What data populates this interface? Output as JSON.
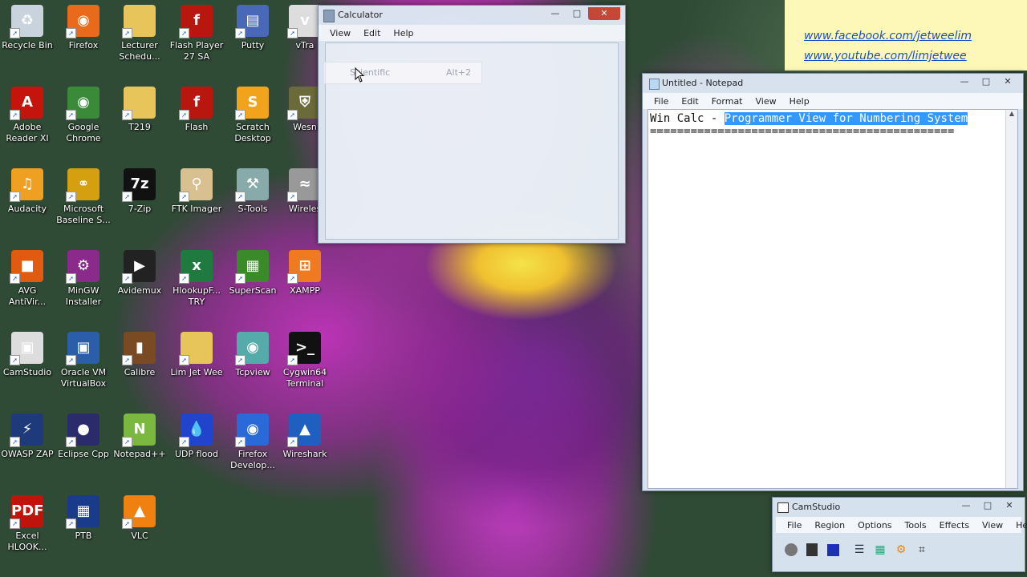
{
  "desktop_icons": [
    {
      "label": "Recycle Bin",
      "icon": "recycle-bin-icon"
    },
    {
      "label": "Firefox",
      "icon": "firefox-icon"
    },
    {
      "label": "Lecturer Schedu...",
      "icon": "folder-icon"
    },
    {
      "label": "Flash Player 27 SA",
      "icon": "flash-icon"
    },
    {
      "label": "Putty",
      "icon": "putty-icon"
    },
    {
      "label": "vTra",
      "icon": "vtrace-icon"
    },
    {
      "label": "Adobe Reader XI",
      "icon": "adobe-reader-icon"
    },
    {
      "label": "Google Chrome",
      "icon": "chrome-icon"
    },
    {
      "label": "T219",
      "icon": "folder-icon"
    },
    {
      "label": "Flash",
      "icon": "flash-icon"
    },
    {
      "label": "Scratch Desktop",
      "icon": "scratch-icon"
    },
    {
      "label": "Wesn",
      "icon": "shield-icon"
    },
    {
      "label": "Audacity",
      "icon": "audacity-icon"
    },
    {
      "label": "Microsoft Baseline S...",
      "icon": "lock-icon"
    },
    {
      "label": "7-Zip",
      "icon": "7zip-icon"
    },
    {
      "label": "FTK Imager",
      "icon": "magnifier-icon"
    },
    {
      "label": "S-Tools",
      "icon": "tools-icon"
    },
    {
      "label": "Wireles",
      "icon": "wireless-icon"
    },
    {
      "label": "AVG AntiVir...",
      "icon": "avg-icon"
    },
    {
      "label": "MinGW Installer",
      "icon": "mingw-icon"
    },
    {
      "label": "Avidemux",
      "icon": "clapper-icon"
    },
    {
      "label": "HlookupF... TRY",
      "icon": "excel-icon"
    },
    {
      "label": "SuperScan",
      "icon": "superscan-icon"
    },
    {
      "label": "XAMPP",
      "icon": "xampp-icon"
    },
    {
      "label": "CamStudio",
      "icon": "camstudio-icon"
    },
    {
      "label": "Oracle VM VirtualBox",
      "icon": "virtualbox-icon"
    },
    {
      "label": "Calibre",
      "icon": "books-icon"
    },
    {
      "label": "Lim Jet Wee",
      "icon": "folder-icon"
    },
    {
      "label": "Tcpview",
      "icon": "tcpview-icon"
    },
    {
      "label": "Cygwin64 Terminal",
      "icon": "terminal-icon"
    },
    {
      "label": "OWASP ZAP",
      "icon": "zap-icon"
    },
    {
      "label": "Eclipse Cpp",
      "icon": "eclipse-icon"
    },
    {
      "label": "Notepad++",
      "icon": "notepadpp-icon"
    },
    {
      "label": "UDP flood",
      "icon": "droplets-icon"
    },
    {
      "label": "Firefox Develop...",
      "icon": "firefox-dev-icon"
    },
    {
      "label": "Wireshark",
      "icon": "wireshark-icon"
    },
    {
      "label": "Excel HLOOK...",
      "icon": "pdf-icon"
    },
    {
      "label": "PTB",
      "icon": "ptb-icon"
    },
    {
      "label": "VLC",
      "icon": "vlc-cone-icon"
    }
  ],
  "calculator": {
    "title": "Calculator",
    "menu": [
      "View",
      "Edit",
      "Help"
    ],
    "dropdown_item": "Scientific",
    "dropdown_shortcut": "Alt+2"
  },
  "promo": {
    "link1": "www.facebook.com/jetweelim",
    "link2": "www.youtube.com/limjetwee"
  },
  "notepad": {
    "title": "Untitled - Notepad",
    "menu": [
      "File",
      "Edit",
      "Format",
      "View",
      "Help"
    ],
    "line1_prefix": "Win Calc - ",
    "line1_selected": "Programmer View for Numbering System",
    "line2": "============================================="
  },
  "camstudio": {
    "title": "CamStudio",
    "menu": [
      "File",
      "Region",
      "Options",
      "Tools",
      "Effects",
      "View",
      "Help"
    ]
  },
  "colors": {
    "selection": "#3399ff",
    "link": "#1b4fc7",
    "promo_bg": "#fdf8b8"
  }
}
